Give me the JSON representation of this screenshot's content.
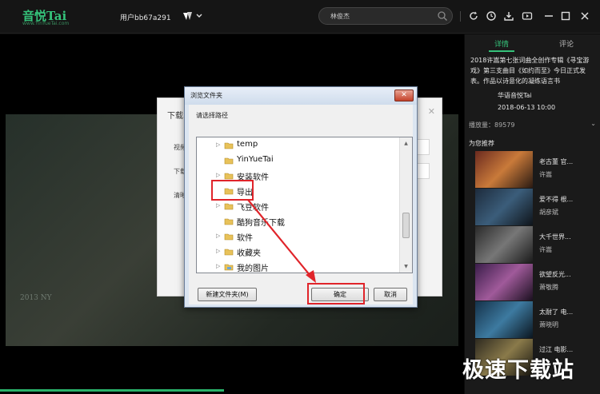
{
  "app": {
    "logo_text": "音悦Tai",
    "logo_sub": "www.YinYueTai.com",
    "user_label": "用户bb67a291"
  },
  "search": {
    "value": "林俊杰"
  },
  "download_dialog": {
    "title": "下载",
    "rows": [
      "视频",
      "下载",
      "清晰"
    ]
  },
  "browse_dialog": {
    "title": "浏览文件夹",
    "prompt": "请选择路径",
    "folders": [
      {
        "label": "temp",
        "expandable": true
      },
      {
        "label": "YinYueTai",
        "expandable": false
      },
      {
        "label": "安装软件",
        "expandable": true
      },
      {
        "label": "导出",
        "expandable": false,
        "selected": true
      },
      {
        "label": "飞豆软件",
        "expandable": true
      },
      {
        "label": "酷狗音乐下载",
        "expandable": false
      },
      {
        "label": "软件",
        "expandable": true
      },
      {
        "label": "收藏夹",
        "expandable": true
      },
      {
        "label": "我的图片",
        "expandable": true
      }
    ],
    "new_folder_button": "新建文件夹(M)",
    "ok_button": "确定",
    "cancel_button": "取消"
  },
  "player": {
    "frame_stamp": "2013 NY"
  },
  "sidebar": {
    "tab_details": "详情",
    "tab_comments": "评论",
    "description": "2018许嵩第七张词曲全创作专辑《寻宝游戏》第三支曲目《如约而至》今日正式发表。作品以诗意化的凝练语言书",
    "artist_tag": "华语音悦Tai",
    "date": "2018-06-13 10:00",
    "plays": "播放量：89579",
    "recommend_heading": "为您推荐",
    "recommendations": [
      {
        "title": "老古董 官...",
        "artist": "许嵩"
      },
      {
        "title": "爱不得 根...",
        "artist": "胡彦斌"
      },
      {
        "title": "大千世界...",
        "artist": "许嵩"
      },
      {
        "title": "欲望反光...",
        "artist": "萧敬腾"
      },
      {
        "title": "太耐了 电...",
        "artist": "萧晓明"
      },
      {
        "title": "过江 电影...",
        "artist": ""
      }
    ],
    "watermark": "极速下载站"
  },
  "colors": {
    "accent": "#35c27a",
    "annotation": "#e0242a"
  }
}
